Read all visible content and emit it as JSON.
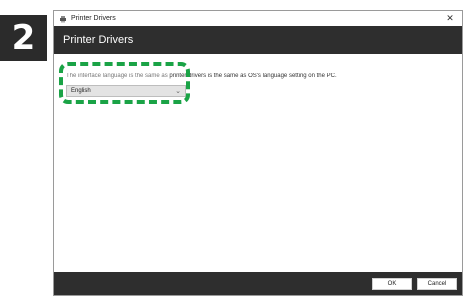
{
  "step": {
    "number": "2"
  },
  "window": {
    "title": "Printer Drivers",
    "close_glyph": "✕"
  },
  "header": {
    "title": "Printer Drivers"
  },
  "content": {
    "description_masked": "The interface language is the same as ",
    "description": "printer drivers is the same as OS's language setting on the PC.",
    "language_select": {
      "selected": "English",
      "chevron": "⌄"
    }
  },
  "footer": {
    "ok_label": "OK",
    "cancel_label": "Cancel"
  },
  "colors": {
    "header_bg": "#2e2e2e",
    "highlight": "#1aa346"
  }
}
